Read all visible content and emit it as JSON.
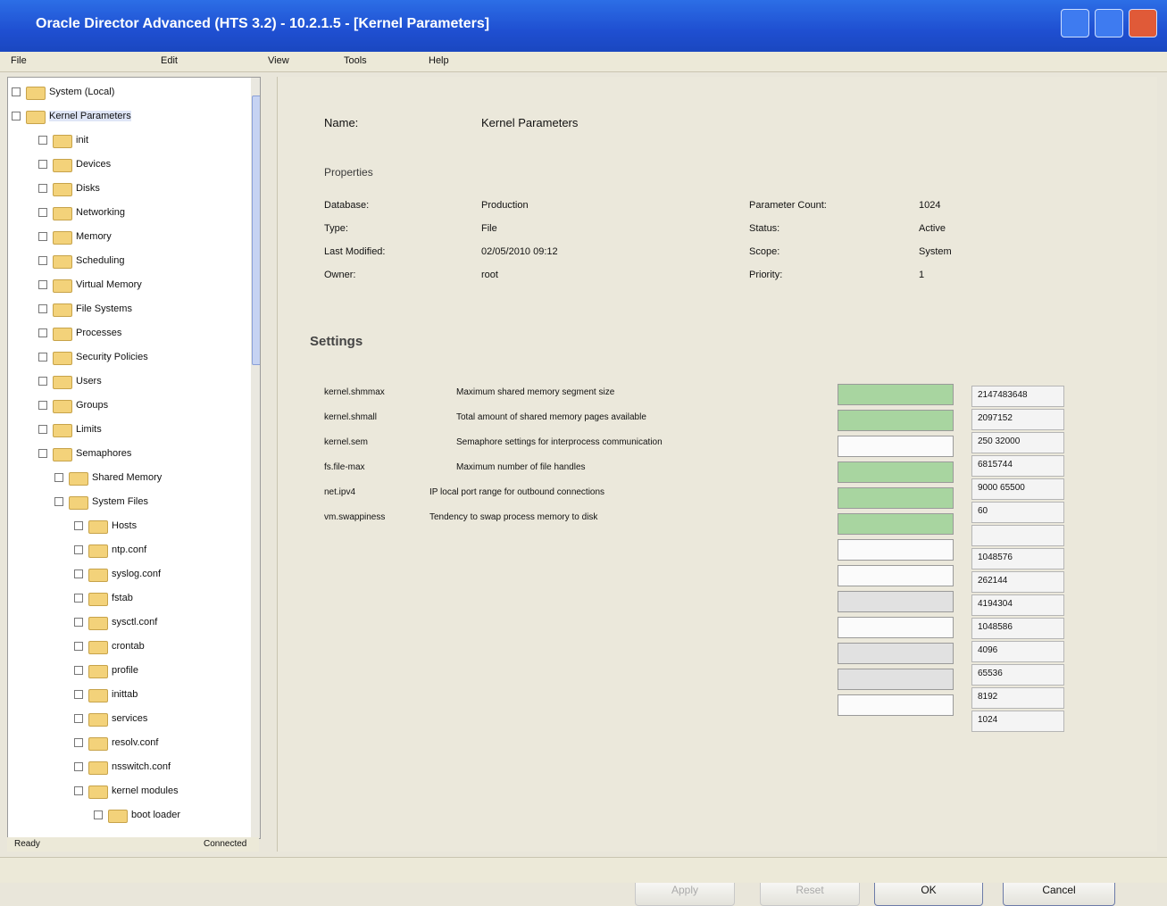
{
  "window": {
    "title": "Oracle Director Advanced (HTS 3.2) - 10.2.1.5 - [Kernel Parameters]"
  },
  "menu": [
    "File",
    "Edit",
    "View",
    "Tools",
    "Help"
  ],
  "tree": {
    "items": [
      {
        "label": "System (Local)"
      },
      {
        "label": "Kernel Parameters"
      },
      {
        "label": "init"
      },
      {
        "label": "Devices"
      },
      {
        "label": "Disks"
      },
      {
        "label": "Networking"
      },
      {
        "label": "Memory"
      },
      {
        "label": "Scheduling"
      },
      {
        "label": "Virtual Memory"
      },
      {
        "label": "File Systems"
      },
      {
        "label": "Processes"
      },
      {
        "label": "Security Policies"
      },
      {
        "label": "Users"
      },
      {
        "label": "Groups"
      },
      {
        "label": "Limits"
      },
      {
        "label": "Semaphores"
      },
      {
        "label": "Shared Memory"
      },
      {
        "label": "System Files"
      },
      {
        "label": "Hosts"
      },
      {
        "label": "ntp.conf"
      },
      {
        "label": "syslog.conf"
      },
      {
        "label": "fstab"
      },
      {
        "label": "sysctl.conf"
      },
      {
        "label": "crontab"
      },
      {
        "label": "profile"
      },
      {
        "label": "inittab"
      },
      {
        "label": "services"
      },
      {
        "label": "resolv.conf"
      },
      {
        "label": "nsswitch.conf"
      },
      {
        "label": "kernel modules"
      },
      {
        "label": "boot loader"
      }
    ],
    "status_left": "Ready",
    "status_right": "Connected"
  },
  "panel": {
    "header_label": "Name:",
    "header_value": "Kernel Parameters",
    "group_title": "Properties",
    "fields_left": [
      {
        "label": "Database:",
        "value": "Production"
      },
      {
        "label": "Type:",
        "value": "File"
      },
      {
        "label": "Last Modified:",
        "value": "02/05/2010 09:12"
      },
      {
        "label": "Owner:",
        "value": "root"
      }
    ],
    "fields_right": [
      {
        "label": "Parameter Count:",
        "value": "1024"
      },
      {
        "label": "Status:",
        "value": "Active"
      },
      {
        "label": "Scope:",
        "value": "System"
      },
      {
        "label": "Priority:",
        "value": "1"
      }
    ],
    "section_title": "Settings",
    "settings": [
      {
        "label": "kernel.shmmax",
        "value": "Maximum shared memory segment size"
      },
      {
        "label": "kernel.shmall",
        "value": "Total amount of shared memory pages available"
      },
      {
        "label": "kernel.sem",
        "value": "Semaphore settings for interprocess communication"
      },
      {
        "label": "fs.file-max",
        "value": "Maximum number of file handles"
      },
      {
        "label": "net.ipv4",
        "value": "IP local port range for outbound connections"
      },
      {
        "label": "vm.swappiness",
        "value": "Tendency to swap process memory to disk"
      }
    ],
    "spin_values": [
      "2147483648",
      "2097152",
      "250 32000",
      "6815744",
      "9000 65500",
      "60",
      "",
      "1048576",
      "262144",
      "4194304",
      "1048586",
      "4096",
      "65536",
      "8192",
      "1024"
    ],
    "buttons": {
      "apply": "Apply",
      "reset": "Reset",
      "ok": "OK",
      "cancel": "Cancel"
    }
  }
}
